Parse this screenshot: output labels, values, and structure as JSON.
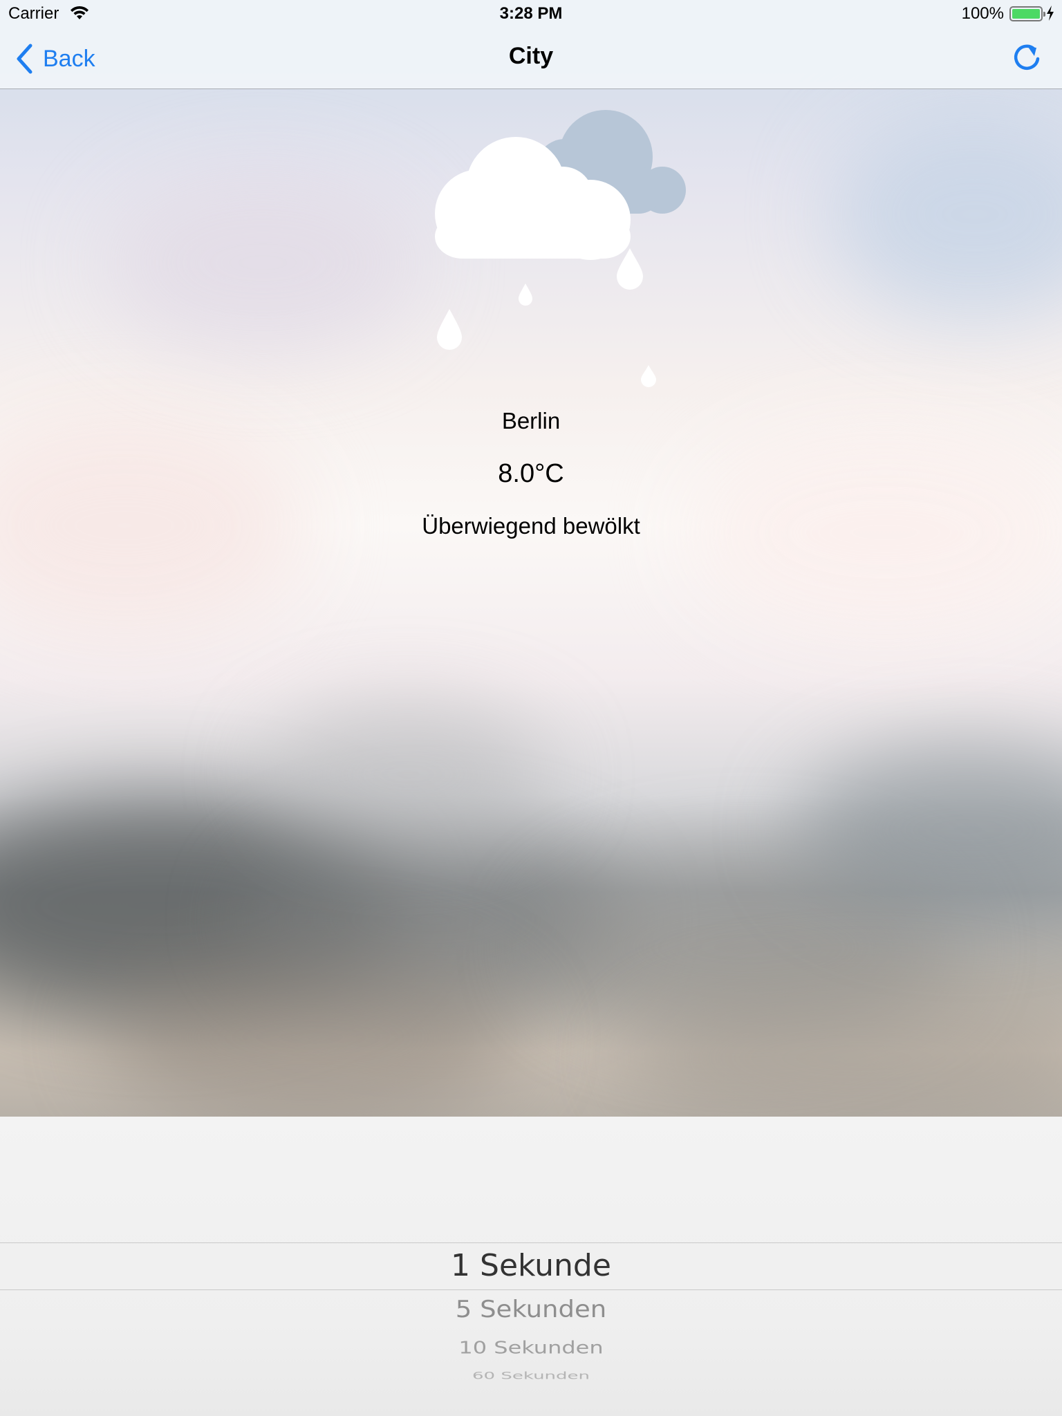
{
  "status_bar": {
    "carrier": "Carrier",
    "time": "3:28 PM",
    "battery": "100%"
  },
  "nav": {
    "back_label": "Back",
    "title": "City"
  },
  "weather": {
    "icon": "rain-cloud-icon",
    "city": "Berlin",
    "temperature": "8.0°C",
    "condition": "Überwiegend bewölkt"
  },
  "picker": {
    "selected": "1 Sekunde",
    "options": [
      "5 Sekunden",
      "10 Sekunden",
      "60 Sekunden"
    ]
  },
  "colors": {
    "accent": "#1e7ef0",
    "battery": "#4cd964"
  }
}
